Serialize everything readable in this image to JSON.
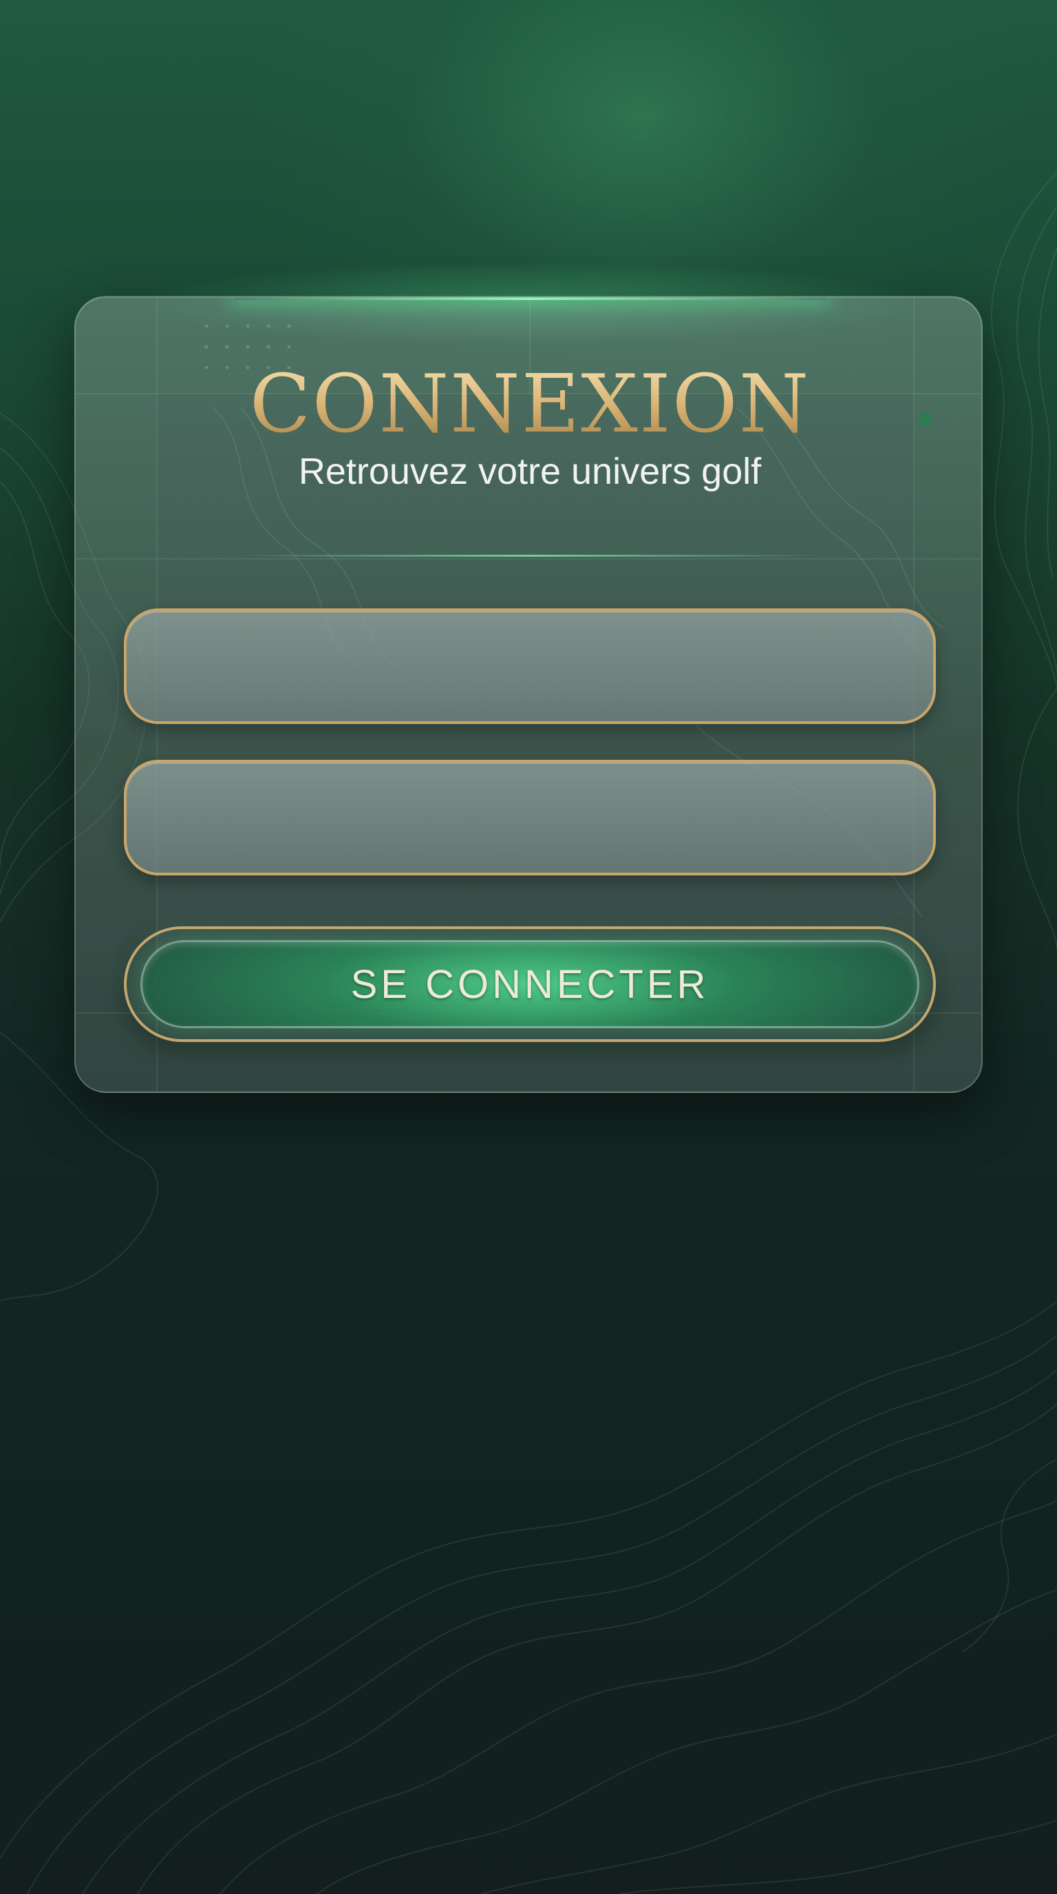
{
  "login": {
    "title": "CONNEXION",
    "subtitle": "Retrouvez votre univers golf",
    "submit_label": "SE CONNECTER"
  },
  "colors": {
    "background_top": "#1f5a3f",
    "background_bottom": "#121f1e",
    "gold_accent": "#c9a56b",
    "button_green": "#3fbf7f",
    "text_light": "#f1f3f0"
  }
}
